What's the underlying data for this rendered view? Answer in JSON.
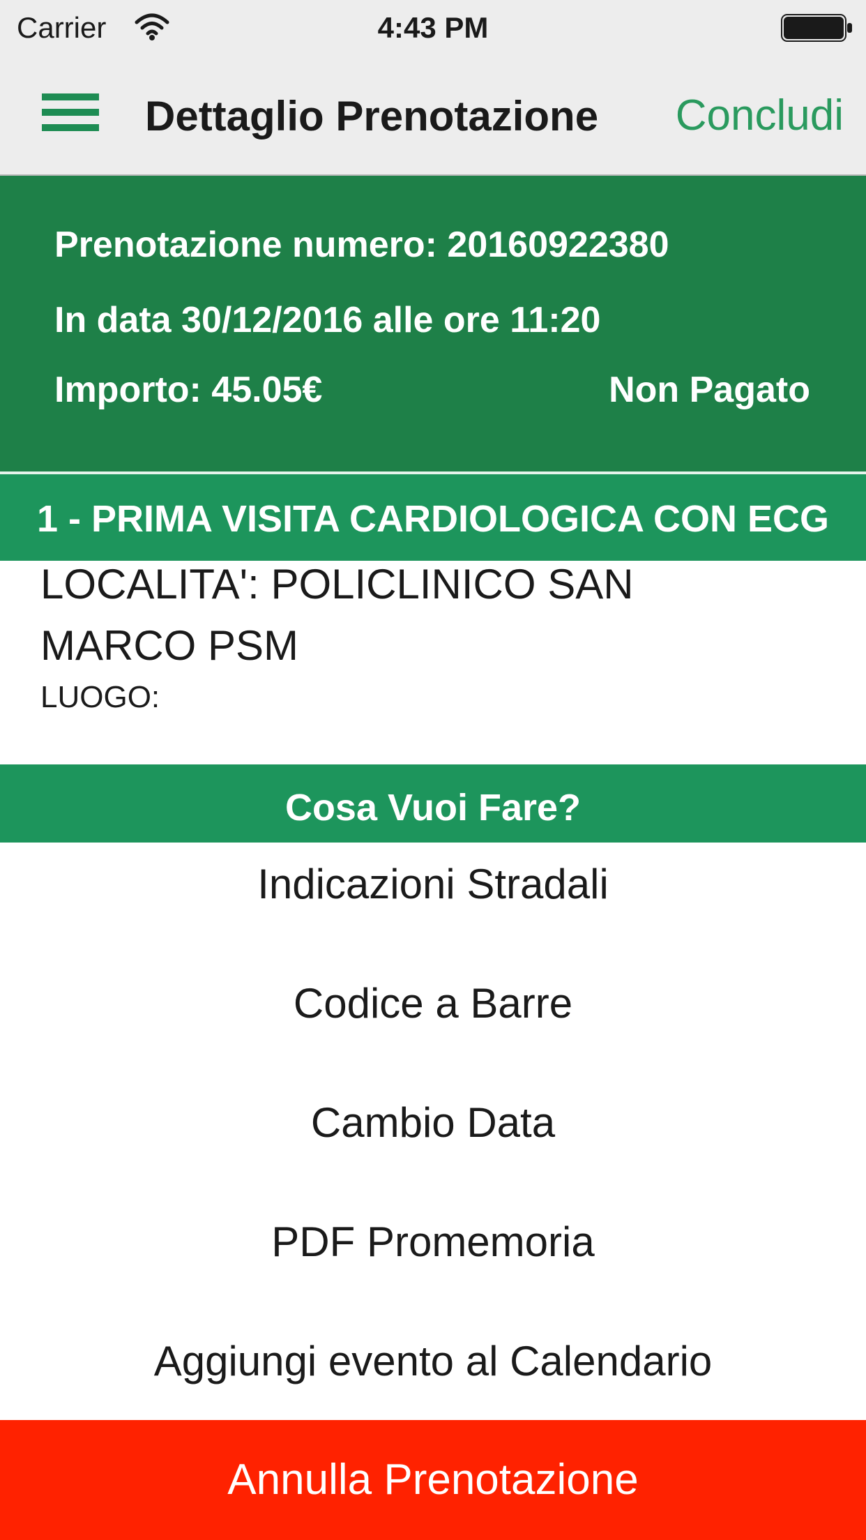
{
  "status_bar": {
    "carrier": "Carrier",
    "time": "4:43 PM",
    "wifi_icon": "wifi-icon",
    "battery_icon": "battery-icon"
  },
  "nav_bar": {
    "menu_icon": "hamburger-menu-icon",
    "title": "Dettaglio Prenotazione",
    "done_label": "Concludi"
  },
  "booking": {
    "number_line": "Prenotazione numero: 20160922380",
    "date_line": "In data 30/12/2016 alle ore 11:20",
    "amount_line": "Importo: 45.05€",
    "payment_status": "Non Pagato"
  },
  "service": {
    "title": "1 - PRIMA VISITA CARDIOLOGICA CON ECG",
    "location": "LOCALITA': POLICLINICO SAN\nMARCO      PSM",
    "place": "LUOGO:"
  },
  "actions": {
    "header": "Cosa Vuoi Fare?",
    "items": [
      {
        "label": "Indicazioni Stradali"
      },
      {
        "label": "Codice a Barre"
      },
      {
        "label": "Cambio Data"
      },
      {
        "label": "PDF Promemoria"
      },
      {
        "label": "Aggiungi evento al Calendario"
      }
    ],
    "cancel_label": "Annulla Prenotazione"
  },
  "colors": {
    "accent_green": "#1e8c53",
    "summary_green": "#1e8048",
    "section_green": "#1d955c",
    "cancel_red": "#ff2200",
    "bar_gray": "#ededed"
  }
}
